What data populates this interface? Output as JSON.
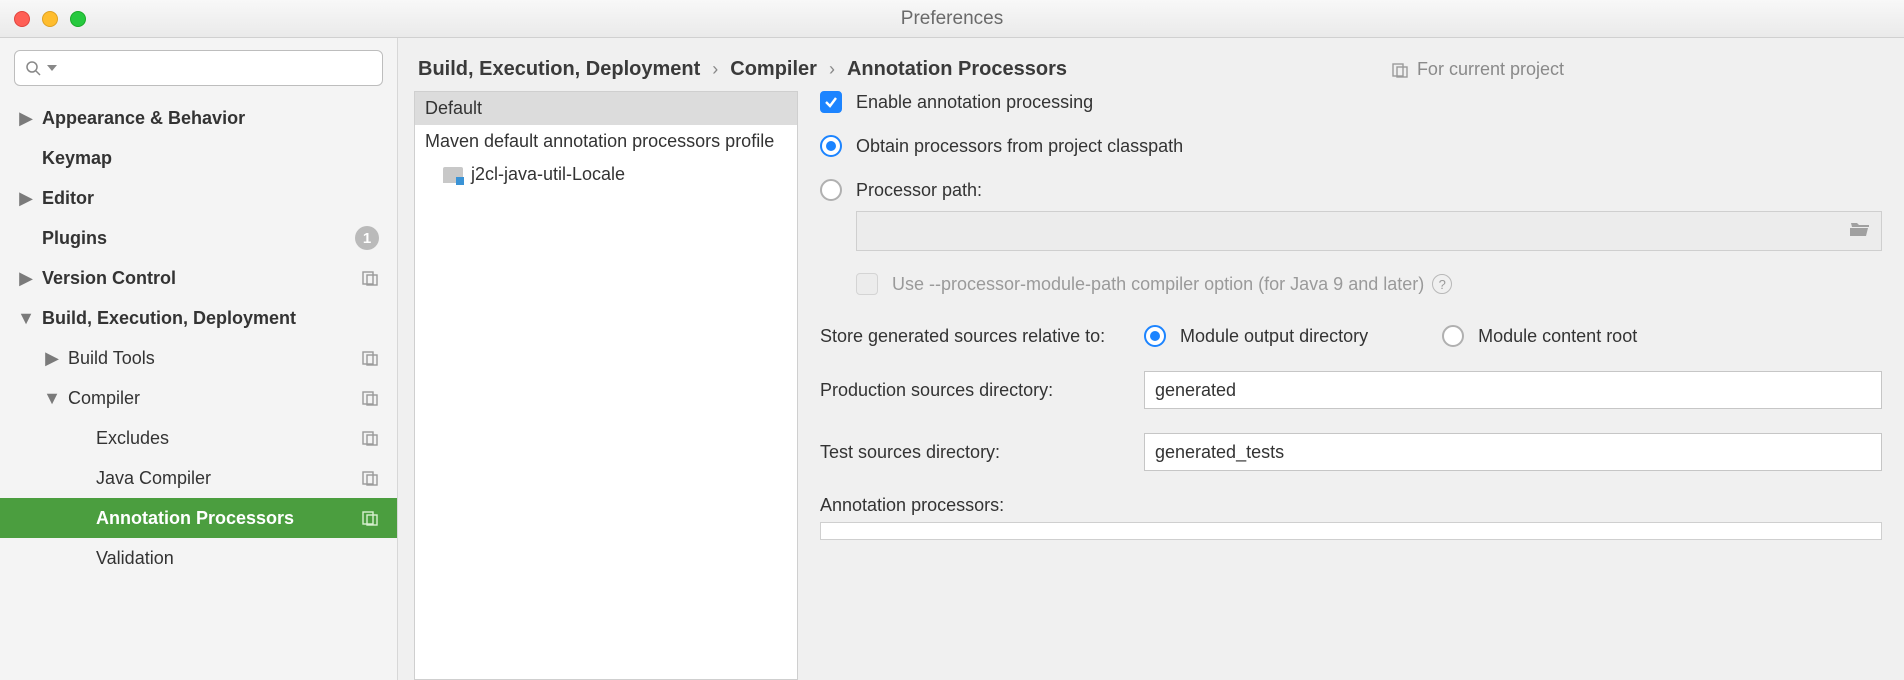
{
  "window": {
    "title": "Preferences"
  },
  "search": {
    "placeholder": ""
  },
  "nav": {
    "appearance": "Appearance & Behavior",
    "keymap": "Keymap",
    "editor": "Editor",
    "plugins": "Plugins",
    "plugins_badge": "1",
    "version_control": "Version Control",
    "bed": "Build, Execution, Deployment",
    "build_tools": "Build Tools",
    "compiler": "Compiler",
    "excludes": "Excludes",
    "java_compiler": "Java Compiler",
    "annotation_processors": "Annotation Processors",
    "validation": "Validation"
  },
  "breadcrumb": {
    "a": "Build, Execution, Deployment",
    "b": "Compiler",
    "c": "Annotation Processors",
    "scope": "For current project"
  },
  "profiles": {
    "default": "Default",
    "maven": "Maven default annotation processors profile",
    "child": "j2cl-java-util-Locale"
  },
  "settings": {
    "enable": "Enable annotation processing",
    "radio_classpath": "Obtain processors from project classpath",
    "radio_path": "Processor path:",
    "module_path_opt": "Use --processor-module-path compiler option (for Java 9 and later)",
    "store_relative": "Store generated sources relative to:",
    "store_out": "Module output directory",
    "store_content": "Module content root",
    "prod_dir_label": "Production sources directory:",
    "prod_dir_value": "generated",
    "test_dir_label": "Test sources directory:",
    "test_dir_value": "generated_tests",
    "ann_proc_label": "Annotation processors:"
  }
}
